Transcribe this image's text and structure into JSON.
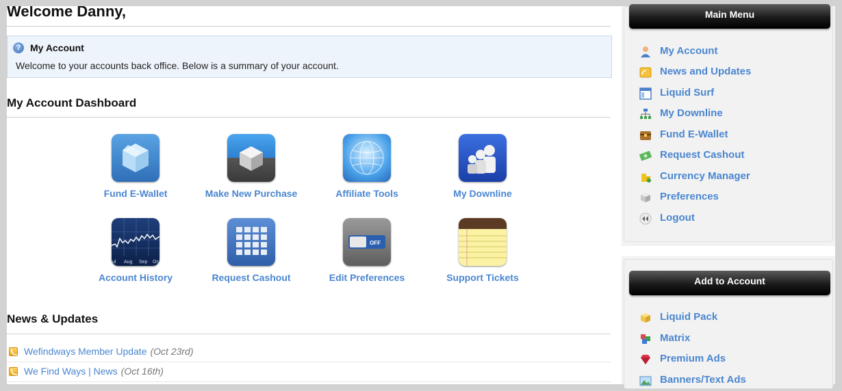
{
  "header": {
    "welcome": "Welcome Danny,"
  },
  "info_box": {
    "title": "My Account",
    "text": "Welcome to your accounts back office. Below is a summary of your account."
  },
  "dashboard": {
    "title": "My Account Dashboard",
    "tiles": [
      {
        "label": "Fund E-Wallet",
        "icon": "box-icon"
      },
      {
        "label": "Make New Purchase",
        "icon": "cube-icon"
      },
      {
        "label": "Affiliate Tools",
        "icon": "globe-icon"
      },
      {
        "label": "My Downline",
        "icon": "people-icon"
      },
      {
        "label": "Account History",
        "icon": "chart-icon",
        "chart_months": [
          "ul",
          "Aug",
          "Sep",
          "Oc"
        ]
      },
      {
        "label": "Request Cashout",
        "icon": "calculator-icon"
      },
      {
        "label": "Edit Preferences",
        "icon": "toggle-icon",
        "toggle_text": "OFF"
      },
      {
        "label": "Support Tickets",
        "icon": "notepad-icon"
      }
    ]
  },
  "news": {
    "title": "News & Updates",
    "items": [
      {
        "title": "Wefindways Member Update",
        "date": "(Oct 23rd)"
      },
      {
        "title": "We Find Ways | News",
        "date": "(Oct 16th)"
      }
    ]
  },
  "main_menu": {
    "title": "Main Menu",
    "items": [
      {
        "label": "My Account",
        "icon": "user-icon"
      },
      {
        "label": "News and Updates",
        "icon": "rss-icon"
      },
      {
        "label": "Liquid Surf",
        "icon": "window-icon"
      },
      {
        "label": "My Downline",
        "icon": "sitemap-icon"
      },
      {
        "label": "Fund E-Wallet",
        "icon": "chest-icon"
      },
      {
        "label": "Request Cashout",
        "icon": "money-icon"
      },
      {
        "label": "Currency Manager",
        "icon": "coins-icon"
      },
      {
        "label": "Preferences",
        "icon": "box-icon"
      },
      {
        "label": "Logout",
        "icon": "rewind-icon"
      }
    ]
  },
  "add_menu": {
    "title": "Add to Account",
    "items": [
      {
        "label": "Liquid Pack",
        "icon": "package-icon"
      },
      {
        "label": "Matrix",
        "icon": "blocks-icon"
      },
      {
        "label": "Premium Ads",
        "icon": "ruby-icon"
      },
      {
        "label": "Banners/Text Ads",
        "icon": "picture-icon"
      }
    ]
  },
  "colors": {
    "link": "#4a86d0",
    "panel_header": "#1a1a1a",
    "info_bg": "#eef4fb"
  }
}
